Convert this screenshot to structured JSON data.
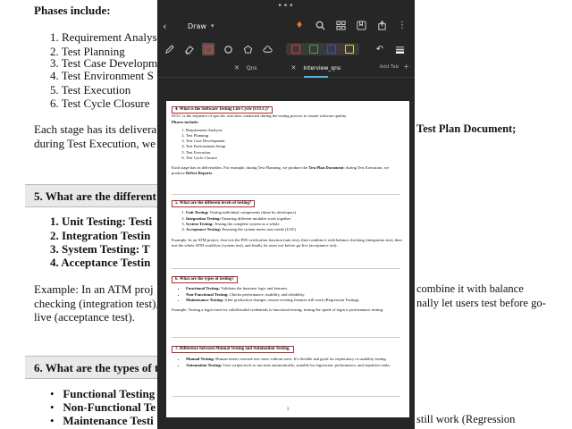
{
  "background": {
    "phases_title": "Phases include:",
    "list_items": [
      "1.  Requirement Analys",
      "2.  Test Planning",
      "3.  Test Case Developm",
      "4.  Test Environment S",
      "5.  Test Execution",
      "6.  Test Cycle Closure"
    ],
    "para_line1": "Each stage has its deliverabl",
    "para_line2": "during Test Execution, we p",
    "right_line1": "Test Plan Document;",
    "heading5": "5. What are the different",
    "levels": [
      "1.  Unit Testing: Testi",
      "2.  Integration Testin",
      "3.  System Testing: T",
      "4.  Acceptance Testin"
    ],
    "example_line1": "Example: In an ATM proj",
    "example_line2": "checking (integration test),",
    "example_line3": "live (acceptance test).",
    "right_ex1": "combine it with balance",
    "right_ex2": "nally let users test before go-",
    "heading6": "6. What are the types of te",
    "types": [
      "Functional Testing",
      "Non-Functional Te",
      "Maintenance Testi"
    ],
    "right_bottom": "still work (Regression",
    "top_fragment": "Phases include:"
  },
  "app": {
    "status_dots": "•••",
    "mode_label": "Draw",
    "tabs": [
      {
        "label": "Qns",
        "active": false
      },
      {
        "label": "Interview_qns",
        "active": true
      }
    ],
    "add_tab_label": "Add Tab",
    "swatch_colors": [
      "#e53935",
      "#43a047",
      "#3f51b5",
      "#f2c94c"
    ]
  },
  "page": {
    "page_number": "3",
    "q4": {
      "title": "4. What is the Software Testing Life Cycle (STLC)?",
      "intro": "STLC is the sequence of specific activities conducted during the testing process to ensure software quality.",
      "phases_label": "Phases include:",
      "phases": [
        "Requirement Analysis",
        "Test Planning",
        "Test Case Development",
        "Test Environment Setup",
        "Test Execution",
        "Test Cycle Closure"
      ],
      "deliverables_a": "Each stage has its deliverables. For example, during Test Planning, we produce the ",
      "deliverables_b": "Test Plan Document",
      "deliverables_c": "; during Test Execution, we produce ",
      "deliverables_d": "Defect Reports",
      "deliverables_e": "."
    },
    "q5": {
      "title": "5. What are the different levels of testing?",
      "items": [
        {
          "term": "Unit Testing:",
          "desc": " Testing individual components (done by developers)."
        },
        {
          "term": "Integration Testing:",
          "desc": " Ensuring different modules work together."
        },
        {
          "term": "System Testing:",
          "desc": " Testing the complete system as a whole."
        },
        {
          "term": "Acceptance Testing:",
          "desc": " Ensuring the system meets user needs (UAT)."
        }
      ],
      "example": "Example: In an ATM project, first test the PIN verification function (unit test), then combine it with balance checking (integration test), then test the whole ATM workflow (system test), and finally let users test before go-live (acceptance test)."
    },
    "q6": {
      "title": "6. What are the types of testing?",
      "items": [
        {
          "term": "Functional Testing:",
          "desc": " Validates the business logic and features."
        },
        {
          "term": "Non-Functional Testing:",
          "desc": " Checks performance, usability, and reliability."
        },
        {
          "term": "Maintenance Testing:",
          "desc": " After production changes, ensure existing features still work (Regression Testing)."
        }
      ],
      "example": "Example: Testing a login form for valid/invalid credentials is functional testing; testing the speed of login is performance testing."
    },
    "q7": {
      "title": "7. Difference between Manual Testing and Automation Testing.",
      "items": [
        {
          "term": "Manual Testing:",
          "desc": " Human testers execute test cases without tools. It's flexible and good for exploratory or usability testing."
        },
        {
          "term": "Automation Testing:",
          "desc": " Uses scripts/tools to run tests automatically; suitable for regression, performance, and repetitive tasks."
        }
      ]
    }
  }
}
